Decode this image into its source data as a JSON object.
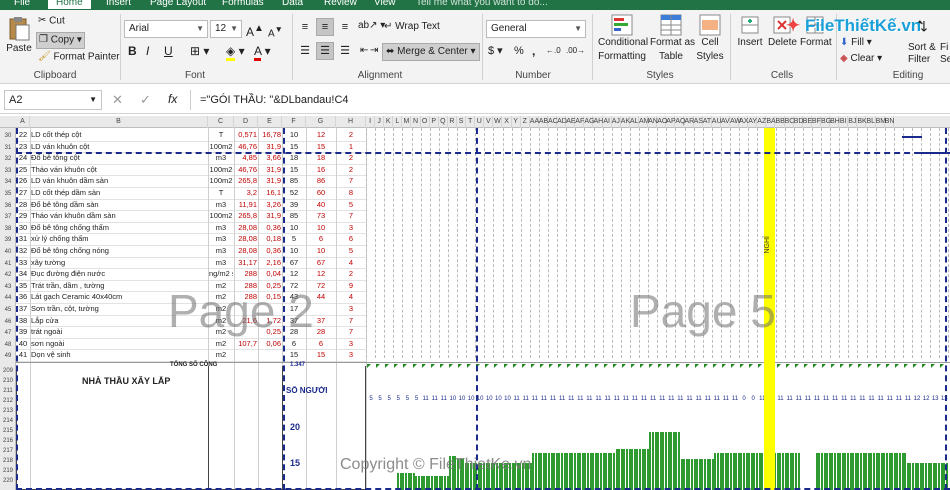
{
  "tabs": [
    "File",
    "Home",
    "Insert",
    "Page Layout",
    "Formulas",
    "Data",
    "Review",
    "View"
  ],
  "tell_me": "Tell me what you want to do...",
  "clipboard": {
    "paste": "Paste",
    "cut": "Cut",
    "copy": "Copy",
    "format_painter": "Format Painter",
    "label": "Clipboard"
  },
  "font": {
    "name": "Arial",
    "size": "12",
    "label": "Font",
    "bold": "B",
    "italic": "I",
    "underline": "U"
  },
  "alignment": {
    "wrap": "Wrap Text",
    "merge": "Merge & Center",
    "label": "Alignment"
  },
  "number": {
    "format": "General",
    "label": "Number",
    "currency": "$",
    "percent": "%",
    "comma": ","
  },
  "styles": {
    "conditional": "Conditional",
    "conditional2": "Formatting",
    "format_as": "Format as",
    "format_as2": "Table",
    "cell_styles": "Cell",
    "cell_styles2": "Styles",
    "label": "Styles"
  },
  "cells": {
    "insert": "Insert",
    "delete": "Delete",
    "format": "Format",
    "label": "Cells"
  },
  "editing": {
    "fill": "Fill",
    "clear": "Clear",
    "sort": "Sort &",
    "filter": "Filter",
    "find": "Fi",
    "select": "Se",
    "label": "Editing"
  },
  "logo": "FileThiếtKế.vn",
  "formula_bar": {
    "cell_ref": "A2",
    "fx": "fx",
    "formula": "=\"GÓI THẦU: \"&DLbandau!C4"
  },
  "columns": [
    "A",
    "B",
    "C",
    "D",
    "E",
    "F",
    "G",
    "H",
    "I",
    "J",
    "K",
    "L",
    "M",
    "N",
    "O",
    "P",
    "Q",
    "R",
    "S",
    "T",
    "U",
    "V",
    "W",
    "X",
    "Y",
    "Z",
    "AA",
    "AB",
    "AC",
    "AD",
    "AE",
    "AF",
    "AG",
    "AH",
    "AI",
    "AJ",
    "AK",
    "AL",
    "AM",
    "AN",
    "AO",
    "AP",
    "AQ",
    "AR",
    "AS",
    "AT",
    "AU",
    "AV",
    "AW",
    "AX",
    "AY",
    "AZ",
    "BA",
    "BB",
    "BC",
    "BD",
    "BE",
    "BF",
    "BG",
    "BH",
    "BI",
    "BJ",
    "BK",
    "BL",
    "BM",
    "BN"
  ],
  "rows": [
    {
      "rn": "30",
      "a": "22",
      "b": "LD cốt thép cột",
      "c": "T",
      "d": "0,571",
      "e": "16,78",
      "f": "10",
      "g": "12",
      "h": "2"
    },
    {
      "rn": "31",
      "a": "23",
      "b": "LD ván khuôn cột",
      "c": "100m2",
      "d": "46,76",
      "e": "31,9",
      "f": "15",
      "g": "15",
      "h": "1"
    },
    {
      "rn": "32",
      "a": "24",
      "b": "Đổ bê tông cột",
      "c": "m3",
      "d": "4,85",
      "e": "3,66",
      "f": "18",
      "g": "18",
      "h": "2"
    },
    {
      "rn": "33",
      "a": "25",
      "b": "Tháo ván khuôn cột",
      "c": "100m2",
      "d": "46,76",
      "e": "31,9",
      "f": "15",
      "g": "16",
      "h": "2"
    },
    {
      "rn": "34",
      "a": "26",
      "b": "LD ván khuôn dầm sàn",
      "c": "100m2",
      "d": "265,8",
      "e": "31,9",
      "f": "85",
      "g": "86",
      "h": "7"
    },
    {
      "rn": "35",
      "a": "27",
      "b": "LD cốt thép dầm sàn",
      "c": "T",
      "d": "3,2",
      "e": "16,1",
      "f": "52",
      "g": "60",
      "h": "8"
    },
    {
      "rn": "36",
      "a": "28",
      "b": "Đổ bê tông dầm sàn",
      "c": "m3",
      "d": "11,91",
      "e": "3,26",
      "f": "39",
      "g": "40",
      "h": "5"
    },
    {
      "rn": "37",
      "a": "29",
      "b": "Tháo ván khuôn dầm sàn",
      "c": "100m2",
      "d": "265,8",
      "e": "31,9",
      "f": "85",
      "g": "73",
      "h": "7"
    },
    {
      "rn": "38",
      "a": "30",
      "b": "Đổ bê tông chống thấm",
      "c": "m3",
      "d": "28,08",
      "e": "0,36",
      "f": "10",
      "g": "10",
      "h": "3"
    },
    {
      "rn": "39",
      "a": "31",
      "b": "xử lý chống thấm",
      "c": "m3",
      "d": "28,08",
      "e": "0,18",
      "f": "5",
      "g": "6",
      "h": "6"
    },
    {
      "rn": "40",
      "a": "32",
      "b": "Đổ bê tông chống nóng",
      "c": "m3",
      "d": "28,08",
      "e": "0,36",
      "f": "10",
      "g": "10",
      "h": "5"
    },
    {
      "rn": "41",
      "a": "33",
      "b": "xây tường",
      "c": "m3",
      "d": "31,17",
      "e": "2,16",
      "f": "67",
      "g": "67",
      "h": "4"
    },
    {
      "rn": "42",
      "a": "34",
      "b": "Đục đường điện nước",
      "c": "ng/m2 s",
      "d": "288",
      "e": "0,04",
      "f": "12",
      "g": "12",
      "h": "2"
    },
    {
      "rn": "43",
      "a": "35",
      "b": "Trát trần, dầm , tường",
      "c": "m2",
      "d": "288",
      "e": "0,25",
      "f": "72",
      "g": "72",
      "h": "9"
    },
    {
      "rn": "44",
      "a": "36",
      "b": "Lát gạch Ceramic 40x40cm",
      "c": "m2",
      "d": "288",
      "e": "0,15",
      "f": "43",
      "g": "44",
      "h": "4"
    },
    {
      "rn": "45",
      "a": "37",
      "b": "Sơn trần, cột, tường",
      "c": "m2",
      "d": "",
      "e": "",
      "f": "17",
      "g": "",
      "h": "3"
    },
    {
      "rn": "46",
      "a": "38",
      "b": "Lắp cửa",
      "c": "m2",
      "d": "21,6",
      "e": "1,72",
      "f": "37",
      "g": "37",
      "h": "7"
    },
    {
      "rn": "47",
      "a": "39",
      "b": "trát ngoài",
      "c": "m2",
      "d": "",
      "e": "0,25",
      "f": "28",
      "g": "28",
      "h": "7"
    },
    {
      "rn": "48",
      "a": "40",
      "b": "sơn ngoài",
      "c": "m2",
      "d": "107,7",
      "e": "0,06",
      "f": "6",
      "g": "6",
      "h": "3"
    },
    {
      "rn": "49",
      "a": "41",
      "b": "Dọn vệ sinh",
      "c": "m2",
      "d": "",
      "e": "",
      "f": "15",
      "g": "15",
      "h": "3"
    }
  ],
  "summary": {
    "total_label": "TỔNG SỐ CÔNG",
    "total_value": "1.347",
    "contractor": "NHÀ THẦU XÂY LẮP",
    "workers_label": "SỐ NGƯỜI",
    "y_label_20": "20",
    "y_label_15": "15"
  },
  "bottom_rows": [
    "209",
    "210",
    "211",
    "212",
    "213",
    "214",
    "215",
    "216",
    "217",
    "218",
    "219",
    "220"
  ],
  "page_watermarks": {
    "left": "Page 2",
    "right": "Page 5"
  },
  "holiday_label": "NGHỈ",
  "copyright": "Copyright © FileThietKe.vn",
  "worker_counts_row": [
    "5",
    "5",
    "5",
    "5",
    "5",
    "5",
    "11",
    "11",
    "11",
    "10",
    "10",
    "10",
    "10",
    "10",
    "10",
    "10",
    "11",
    "11",
    "11",
    "11",
    "11",
    "11",
    "11",
    "11",
    "11",
    "11",
    "11",
    "11",
    "11",
    "11",
    "11",
    "11",
    "11",
    "11",
    "11",
    "11",
    "11",
    "11",
    "11",
    "11",
    "11",
    "0",
    "0",
    "11",
    "11",
    "11",
    "11",
    "11",
    "11",
    "11",
    "11",
    "11",
    "11",
    "11",
    "11",
    "11",
    "11",
    "11",
    "11",
    "11",
    "12",
    "12",
    "13",
    "13"
  ],
  "histogram": [
    0,
    0,
    0,
    0,
    0,
    0,
    0,
    0,
    0,
    0,
    0,
    0,
    5,
    5,
    5,
    5,
    5,
    5,
    5,
    4,
    4,
    4,
    4,
    4,
    4,
    4,
    4,
    4,
    4,
    4,
    4,
    4,
    10,
    10,
    10,
    9,
    9,
    9,
    8,
    8,
    8,
    8,
    8,
    8,
    8,
    8,
    8,
    8,
    8,
    8,
    8,
    8,
    8,
    8,
    8,
    8,
    8,
    8,
    8,
    8,
    8,
    8,
    8,
    8,
    11,
    11,
    11,
    11,
    11,
    11,
    11,
    11,
    11,
    11,
    11,
    11,
    11,
    11,
    11,
    11,
    11,
    11,
    11,
    11,
    11,
    11,
    11,
    11,
    11,
    11,
    11,
    11,
    11,
    11,
    11,
    11,
    12,
    12,
    12,
    12,
    12,
    12,
    12,
    12,
    12,
    12,
    12,
    12,
    12,
    17,
    17,
    17,
    17,
    17,
    17,
    17,
    17,
    17,
    17,
    17,
    17,
    9,
    9,
    9,
    9,
    9,
    9,
    9,
    9,
    9,
    9,
    9,
    9,
    9,
    11,
    11,
    11,
    11,
    11,
    11,
    11,
    11,
    11,
    11,
    11,
    11,
    11,
    11,
    11,
    11,
    11,
    11,
    11,
    11,
    11,
    11,
    11,
    11,
    11,
    11,
    11,
    11,
    11,
    11,
    11,
    11,
    11,
    0,
    0,
    0,
    0,
    0,
    0,
    11,
    11,
    11,
    11,
    11,
    11,
    11,
    11,
    11,
    11,
    11,
    11,
    11,
    11,
    11,
    11,
    11,
    11,
    11,
    11,
    11,
    11,
    11,
    11,
    11,
    11,
    11,
    11,
    11,
    11,
    11,
    11,
    11,
    11,
    11,
    8,
    8,
    8,
    8,
    8,
    8,
    8,
    8,
    8,
    8,
    8,
    8,
    8,
    8,
    8,
    8,
    8,
    8,
    11,
    11,
    11,
    11,
    11,
    11,
    11,
    11,
    11,
    11,
    11,
    11,
    11,
    11,
    15,
    15,
    15,
    15,
    15,
    15,
    15,
    15,
    15,
    15,
    15,
    15
  ]
}
